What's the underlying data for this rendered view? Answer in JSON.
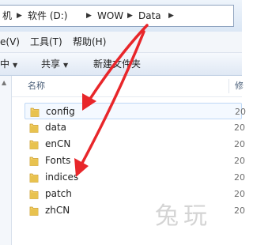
{
  "address_bar": {
    "crumbs": [
      "机",
      "软件 (D:)",
      "WOW",
      "Data"
    ]
  },
  "menu": {
    "items": [
      "e(V)",
      "工具(T)",
      "帮助(H)"
    ]
  },
  "toolbar": {
    "organize_label": "中",
    "share_label": "共享",
    "new_folder_label": "新建文件夹"
  },
  "columns": {
    "name": "名称",
    "modified": "修"
  },
  "files": [
    {
      "name": "config",
      "date": "20"
    },
    {
      "name": "data",
      "date": "20"
    },
    {
      "name": "enCN",
      "date": "20"
    },
    {
      "name": "Fonts",
      "date": "20"
    },
    {
      "name": "indices",
      "date": "20"
    },
    {
      "name": "patch",
      "date": "20"
    },
    {
      "name": "zhCN",
      "date": "20"
    }
  ],
  "watermark": "兔玩",
  "colors": {
    "annotation_arrow": "#e8262a",
    "folder": "#e8c24f",
    "selection_border": "#bfd8f5"
  },
  "icons": {
    "folder": "folder-icon",
    "dropdown": "chevron-down-icon",
    "breadcrumb_separator": "triangle-right-icon"
  }
}
